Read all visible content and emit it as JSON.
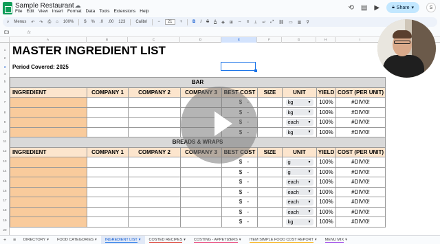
{
  "window": {
    "doc_title": "Sample Restaurant",
    "menu": [
      "File",
      "Edit",
      "View",
      "Insert",
      "Format",
      "Data",
      "Tools",
      "Extensions",
      "Help"
    ],
    "share_label": "Share",
    "avatar_letter": "S"
  },
  "toolbar": {
    "menus_label": "Menus",
    "zoom": "100%",
    "currency": "$",
    "percent": "%",
    "decimal1": ".0",
    "decimal2": ".00",
    "number_format": "123",
    "font": "Calibri",
    "font_size": "21",
    "bold": "B",
    "italic": "I",
    "strike": "S",
    "text_color": "A"
  },
  "formula_bar": {
    "cell_ref": "E3",
    "fx": "fx"
  },
  "columns": [
    "A",
    "B",
    "C",
    "D",
    "E",
    "F",
    "G",
    "H",
    "I"
  ],
  "rows": [
    "1",
    "2",
    "3",
    "4",
    "5",
    "6",
    "7",
    "8",
    "9",
    "10",
    "11",
    "12",
    "13",
    "14",
    "15",
    "16",
    "17",
    "18",
    "19",
    "20"
  ],
  "sheet": {
    "title": "MASTER INGREDIENT LIST",
    "period": "Period Covered: 2025",
    "headers": [
      "INGREDIENT",
      "COMPANY 1",
      "COMPANY 2",
      "COMPANY 3",
      "BEST COST",
      "SIZE",
      "UNIT",
      "YIELD",
      "COST (PER UNIT)"
    ],
    "sections": [
      {
        "name": "BAR",
        "rows": [
          {
            "best_sym": "$",
            "best_val": "-",
            "unit": "kg",
            "yield": "100%",
            "cost": "#DIV/0!"
          },
          {
            "best_sym": "$",
            "best_val": "-",
            "unit": "kg",
            "yield": "100%",
            "cost": "#DIV/0!"
          },
          {
            "best_sym": "$",
            "best_val": "-",
            "unit": "each",
            "yield": "100%",
            "cost": "#DIV/0!"
          },
          {
            "best_sym": "$",
            "best_val": "-",
            "unit": "kg",
            "yield": "100%",
            "cost": "#DIV/0!"
          }
        ]
      },
      {
        "name": "BREADS & WRAPS",
        "rows": [
          {
            "best_sym": "$",
            "best_val": "-",
            "unit": "g",
            "yield": "100%",
            "cost": "#DIV/0!"
          },
          {
            "best_sym": "$",
            "best_val": "-",
            "unit": "g",
            "yield": "100%",
            "cost": "#DIV/0!"
          },
          {
            "best_sym": "$",
            "best_val": "-",
            "unit": "each",
            "yield": "100%",
            "cost": "#DIV/0!"
          },
          {
            "best_sym": "$",
            "best_val": "-",
            "unit": "each",
            "yield": "100%",
            "cost": "#DIV/0!"
          },
          {
            "best_sym": "$",
            "best_val": "-",
            "unit": "each",
            "yield": "100%",
            "cost": "#DIV/0!"
          },
          {
            "best_sym": "$",
            "best_val": "-",
            "unit": "each",
            "yield": "100%",
            "cost": "#DIV/0!"
          },
          {
            "best_sym": "$",
            "best_val": "-",
            "unit": "kg",
            "yield": "100%",
            "cost": "#DIV/0!"
          }
        ]
      }
    ]
  },
  "tabs": [
    {
      "label": "DIRECTORY",
      "active": false,
      "color": ""
    },
    {
      "label": "FOOD CATEGORIES",
      "active": false,
      "color": ""
    },
    {
      "label": "INGREDIENT LIST",
      "active": true,
      "color": "#1a73e8"
    },
    {
      "label": "COSTED RECIPES",
      "active": false,
      "color": "#d93025"
    },
    {
      "label": "COSTING - APPETIZERS",
      "active": false,
      "color": "#e8336d"
    },
    {
      "label": "ITEM SIMPLE FOOD COST REPORT",
      "active": false,
      "color": "#f9ab00"
    },
    {
      "label": "MENU MIX",
      "active": false,
      "color": "#9334e6"
    }
  ],
  "colors": {
    "ingredient_fill": "#f9cb9c",
    "header_fill": "#fce5cd",
    "section_fill": "#d9d9d9",
    "accent": "#1a73e8"
  }
}
